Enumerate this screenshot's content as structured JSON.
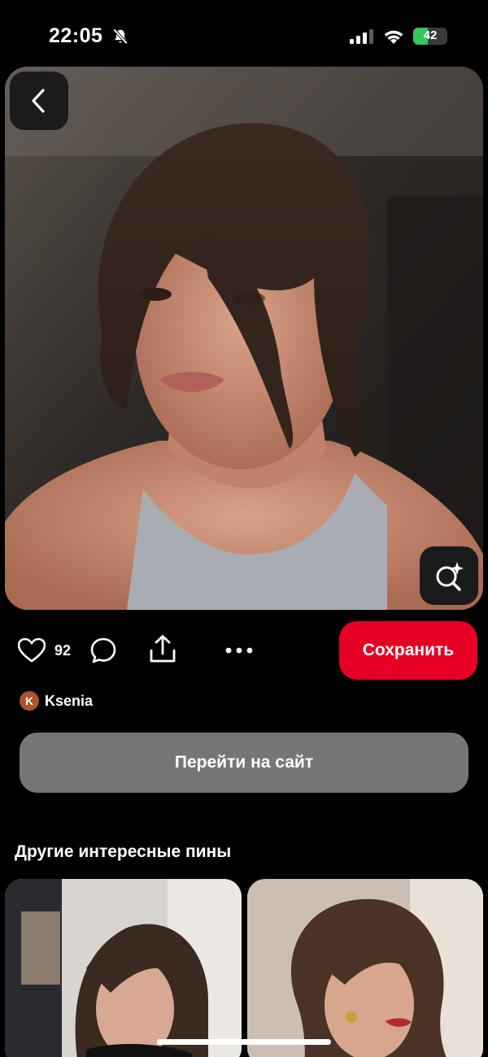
{
  "status_bar": {
    "time": "22:05",
    "battery_level": "42",
    "battery_fraction": 0.42,
    "icons": [
      "bell-off-icon",
      "signal-icon",
      "wifi-icon",
      "battery-charging-icon"
    ]
  },
  "pin": {
    "image_alt": "Woman with curtain bangs and loose updo",
    "like_count": "92",
    "save_label": "Сохранить",
    "author": {
      "initial": "K",
      "name": "Ksenia"
    },
    "visit_label": "Перейти на сайт"
  },
  "more_pins": {
    "title": "Другие интересные пины",
    "items": [
      {
        "alt": "Haircut with curtain bangs in salon"
      },
      {
        "alt": "High ponytail with curtain bangs"
      }
    ]
  },
  "colors": {
    "accent": "#e60023",
    "visit_button": "#767676",
    "battery": "#34c759",
    "avatar": "#b0522a"
  }
}
